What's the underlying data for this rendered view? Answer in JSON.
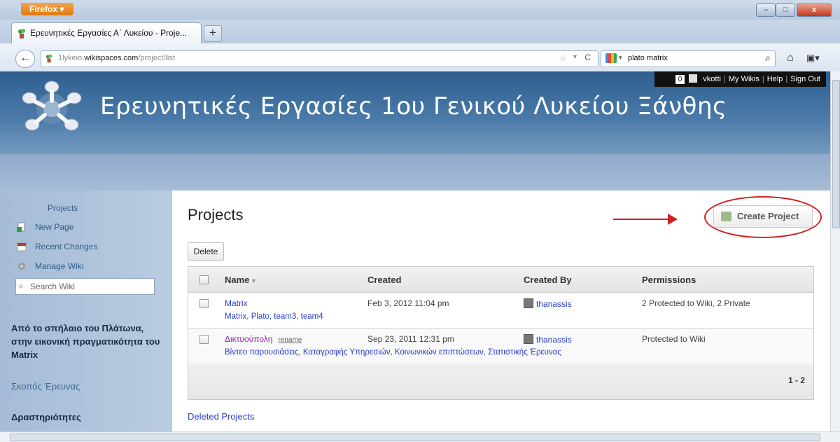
{
  "browser": {
    "app_button": "Firefox ▾",
    "tab_title": "Ερευνητικές Εργασίες Α΄ Λυκείου - Proje...",
    "new_tab": "+",
    "url_prefix": "1lykeio.",
    "url_domain": "wikispaces.com",
    "url_path": "/project/list",
    "search_value": "plato matrix",
    "window_controls": {
      "minimize": "–",
      "maximize": "□",
      "close": "x"
    }
  },
  "userbar": {
    "count": "0",
    "username": "vkotti",
    "my_wikis": "My Wikis",
    "help": "Help",
    "sign_out": "Sign Out"
  },
  "site": {
    "title": "Ερευνητικές Εργασίες 1ου Γενικού Λυκείου Ξάνθης"
  },
  "sidebar": {
    "heading": "Projects",
    "items": [
      {
        "label": "New Page",
        "icon": "new-page-icon",
        "color": "#3a9a3a"
      },
      {
        "label": "Recent Changes",
        "icon": "calendar-icon",
        "color": "#c0392b"
      },
      {
        "label": "Manage Wiki",
        "icon": "gear-icon",
        "color": "#888888"
      }
    ],
    "search_placeholder": "Search Wiki",
    "bold_text": "Από το σπήλαιο του Πλάτωνα, στην εικονική πραγματικότητα του Matrix",
    "link": "Σκοπός Έρευνας",
    "section": "Δραστηριότητες"
  },
  "main": {
    "title": "Projects",
    "create_button": "Create Project",
    "delete_button": "Delete",
    "columns": [
      "Name",
      "Created",
      "Created By",
      "Permissions"
    ],
    "rows": [
      {
        "name": "Matrix",
        "tags": "Matrix, Plato, team3, team4",
        "created": "Feb 3, 2012 11:04 pm",
        "created_by": "thanassis",
        "permissions": "2 Protected to Wiki, 2 Private",
        "rename": ""
      },
      {
        "name": "Δικτυούπολη",
        "tags": "Βίντεο παρουσιάσεις, Καταγραφής Υπηρεσιών, Κοινωνικών επιπτώσεων, Στατιστικής Έρευνας",
        "created": "Sep 23, 2011 12:31 pm",
        "created_by": "thanassis",
        "permissions": "Protected to Wiki",
        "rename": "rename"
      }
    ],
    "pager": "1 - 2",
    "deleted_link": "Deleted Projects"
  },
  "colors": {
    "annotation": "#d21f1f",
    "link": "#2a3bc8",
    "visited": "#9b1fb8",
    "banner": "#2e5f8f"
  }
}
